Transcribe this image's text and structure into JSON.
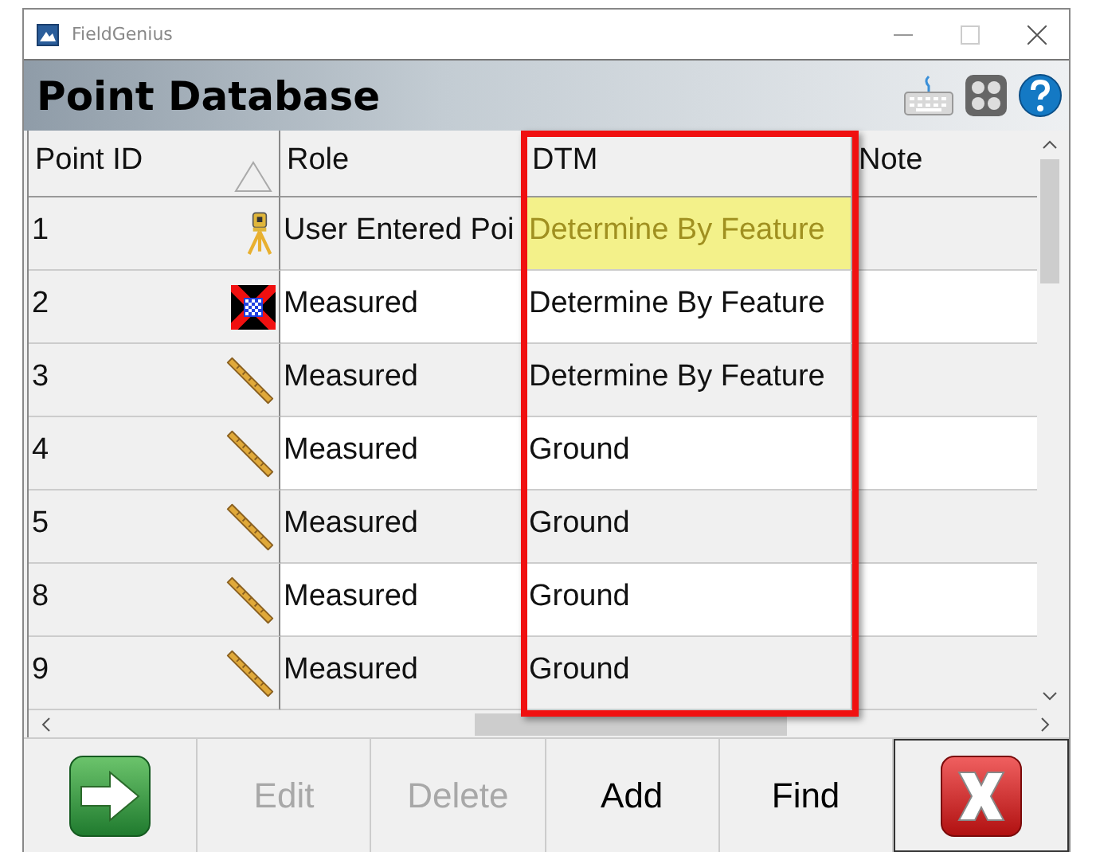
{
  "window": {
    "title": "FieldGenius"
  },
  "header": {
    "title": "Point Database"
  },
  "table": {
    "columns": [
      {
        "label": "Point ID",
        "sorted": true
      },
      {
        "label": "Role",
        "sorted": false
      },
      {
        "label": "DTM",
        "sorted": false
      },
      {
        "label": "Note",
        "sorted": false
      }
    ],
    "rows": [
      {
        "point_id": "1",
        "kind": "tripod",
        "role": "User Entered Poi",
        "dtm": "Determine By Feature",
        "selected": true
      },
      {
        "point_id": "2",
        "kind": "target",
        "role": "Measured",
        "dtm": "Determine By Feature",
        "selected": false
      },
      {
        "point_id": "3",
        "kind": "ruler",
        "role": "Measured",
        "dtm": "Determine By Feature",
        "selected": false
      },
      {
        "point_id": "4",
        "kind": "ruler",
        "role": "Measured",
        "dtm": "Ground",
        "selected": false
      },
      {
        "point_id": "5",
        "kind": "ruler",
        "role": "Measured",
        "dtm": "Ground",
        "selected": false
      },
      {
        "point_id": "8",
        "kind": "ruler",
        "role": "Measured",
        "dtm": "Ground",
        "selected": false
      },
      {
        "point_id": "9",
        "kind": "ruler",
        "role": "Measured",
        "dtm": "Ground",
        "selected": false
      }
    ]
  },
  "buttons": [
    {
      "kind": "next"
    },
    {
      "kind": "text",
      "label": "Edit",
      "disabled": true
    },
    {
      "kind": "text",
      "label": "Delete",
      "disabled": true
    },
    {
      "kind": "text",
      "label": "Add",
      "disabled": false
    },
    {
      "kind": "text",
      "label": "Find",
      "disabled": false
    },
    {
      "kind": "close"
    }
  ]
}
